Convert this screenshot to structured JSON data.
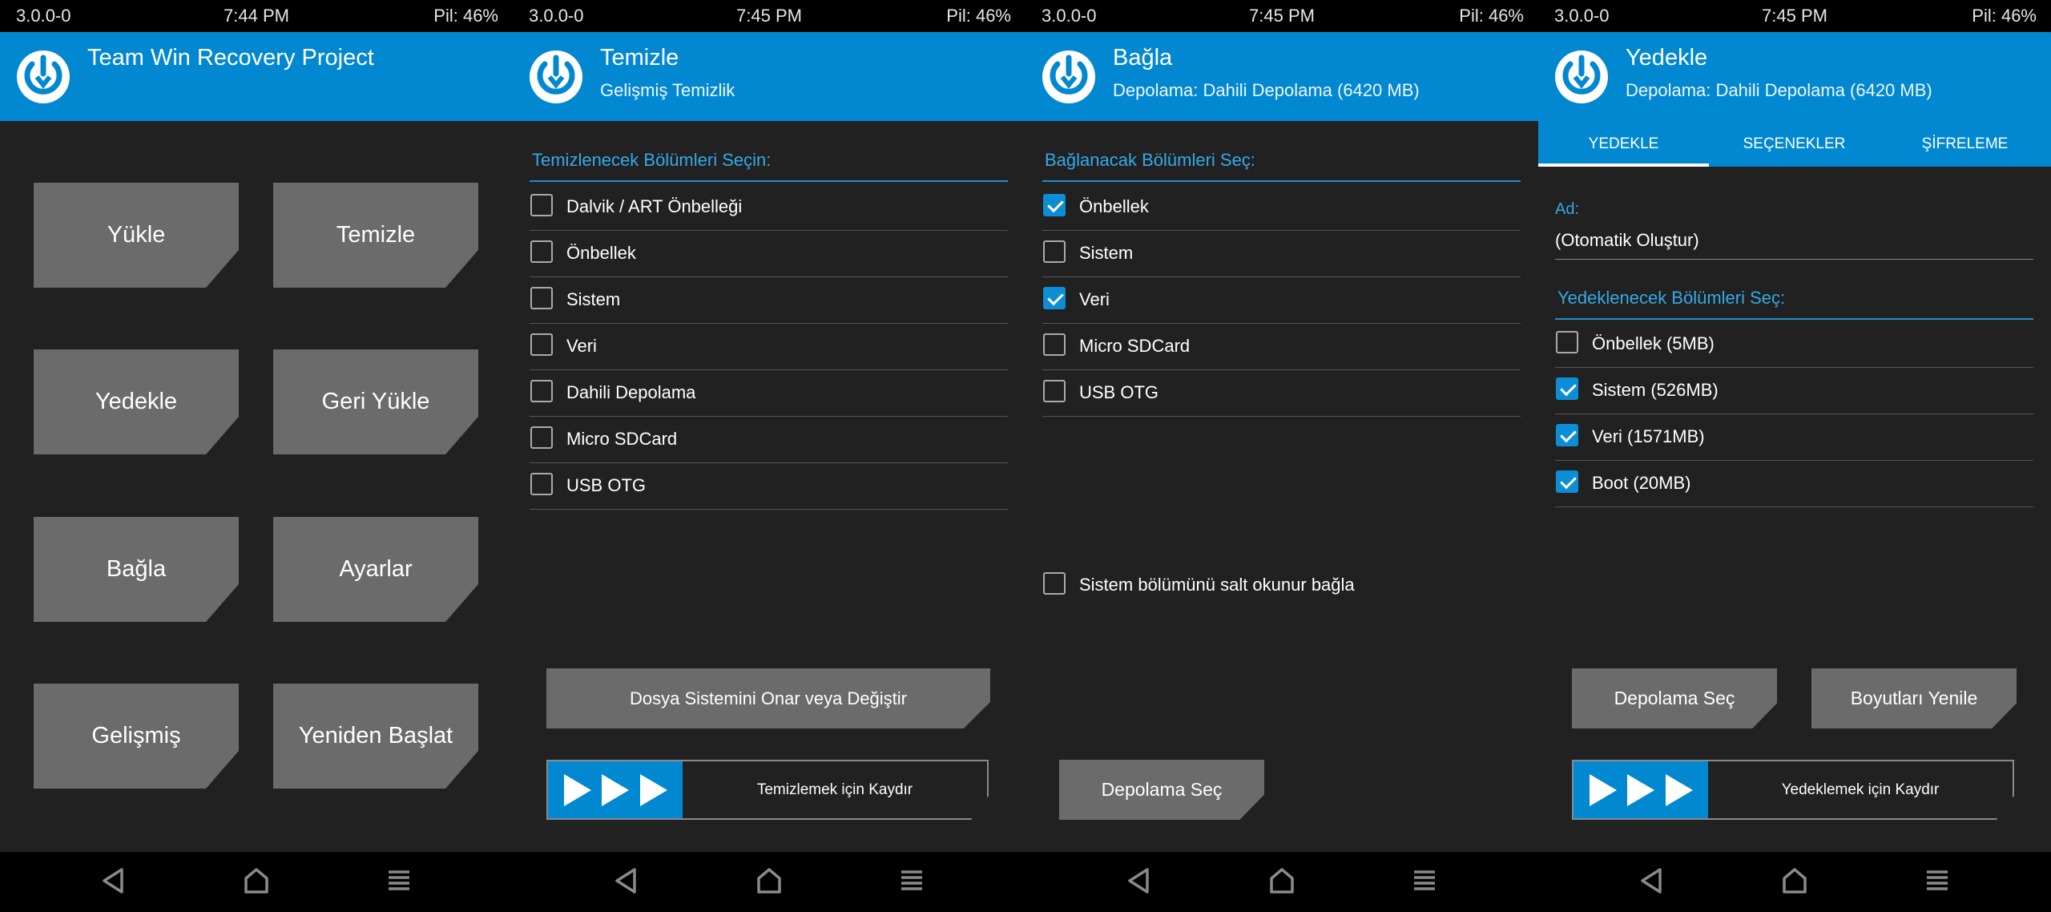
{
  "colors": {
    "accent": "#0288d1",
    "background": "#212121",
    "button": "#6b6b6b",
    "section_label": "#33aaeb"
  },
  "icons": {
    "logo": "twrp-logo-icon",
    "nav": [
      "back-icon",
      "home-icon",
      "menu-icon"
    ]
  },
  "panels": [
    {
      "status": {
        "version": "3.0.0-0",
        "time": "7:44 PM",
        "battery": "Pil: 46%"
      },
      "header": {
        "title": "Team Win Recovery Project",
        "subtitle": ""
      },
      "buttons": [
        "Yükle",
        "Temizle",
        "Yedekle",
        "Geri Yükle",
        "Bağla",
        "Ayarlar",
        "Gelişmiş",
        "Yeniden Başlat"
      ]
    },
    {
      "status": {
        "version": "3.0.0-0",
        "time": "7:45 PM",
        "battery": "Pil: 46%"
      },
      "header": {
        "title": "Temizle",
        "subtitle": "Gelişmiş Temizlik"
      },
      "section_label": "Temizlenecek Bölümleri Seçin:",
      "partitions": [
        {
          "label": "Dalvik / ART Önbelleği",
          "checked": false
        },
        {
          "label": "Önbellek",
          "checked": false
        },
        {
          "label": "Sistem",
          "checked": false
        },
        {
          "label": "Veri",
          "checked": false
        },
        {
          "label": "Dahili Depolama",
          "checked": false
        },
        {
          "label": "Micro SDCard",
          "checked": false
        },
        {
          "label": "USB OTG",
          "checked": false
        }
      ],
      "action_button": "Dosya Sistemini Onar veya Değiştir",
      "swipe_label": "Temizlemek için Kaydır"
    },
    {
      "status": {
        "version": "3.0.0-0",
        "time": "7:45 PM",
        "battery": "Pil: 46%"
      },
      "header": {
        "title": "Bağla",
        "subtitle": "Depolama: Dahili Depolama (6420 MB)"
      },
      "section_label": "Bağlanacak Bölümleri Seç:",
      "partitions": [
        {
          "label": "Önbellek",
          "checked": true
        },
        {
          "label": "Sistem",
          "checked": false
        },
        {
          "label": "Veri",
          "checked": true
        },
        {
          "label": "Micro SDCard",
          "checked": false
        },
        {
          "label": "USB OTG",
          "checked": false
        }
      ],
      "readonly_option": {
        "label": "Sistem bölümünü salt okunur bağla",
        "checked": false
      },
      "storage_button": "Depolama Seç"
    },
    {
      "status": {
        "version": "3.0.0-0",
        "time": "7:45 PM",
        "battery": "Pil: 46%"
      },
      "header": {
        "title": "Yedekle",
        "subtitle": "Depolama: Dahili Depolama (6420 MB)"
      },
      "tabs": [
        "YEDEKLE",
        "SEÇENEKLER",
        "ŞİFRELEME"
      ],
      "name_label": "Ad:",
      "name_value": "(Otomatik Oluştur)",
      "section_label": "Yedeklenecek Bölümleri Seç:",
      "partitions": [
        {
          "label": "Önbellek (5MB)",
          "checked": false
        },
        {
          "label": "Sistem (526MB)",
          "checked": true
        },
        {
          "label": "Veri (1571MB)",
          "checked": true
        },
        {
          "label": "Boot (20MB)",
          "checked": true
        }
      ],
      "storage_button": "Depolama Seç",
      "refresh_button": "Boyutları Yenile",
      "swipe_label": "Yedeklemek için Kaydır"
    }
  ]
}
